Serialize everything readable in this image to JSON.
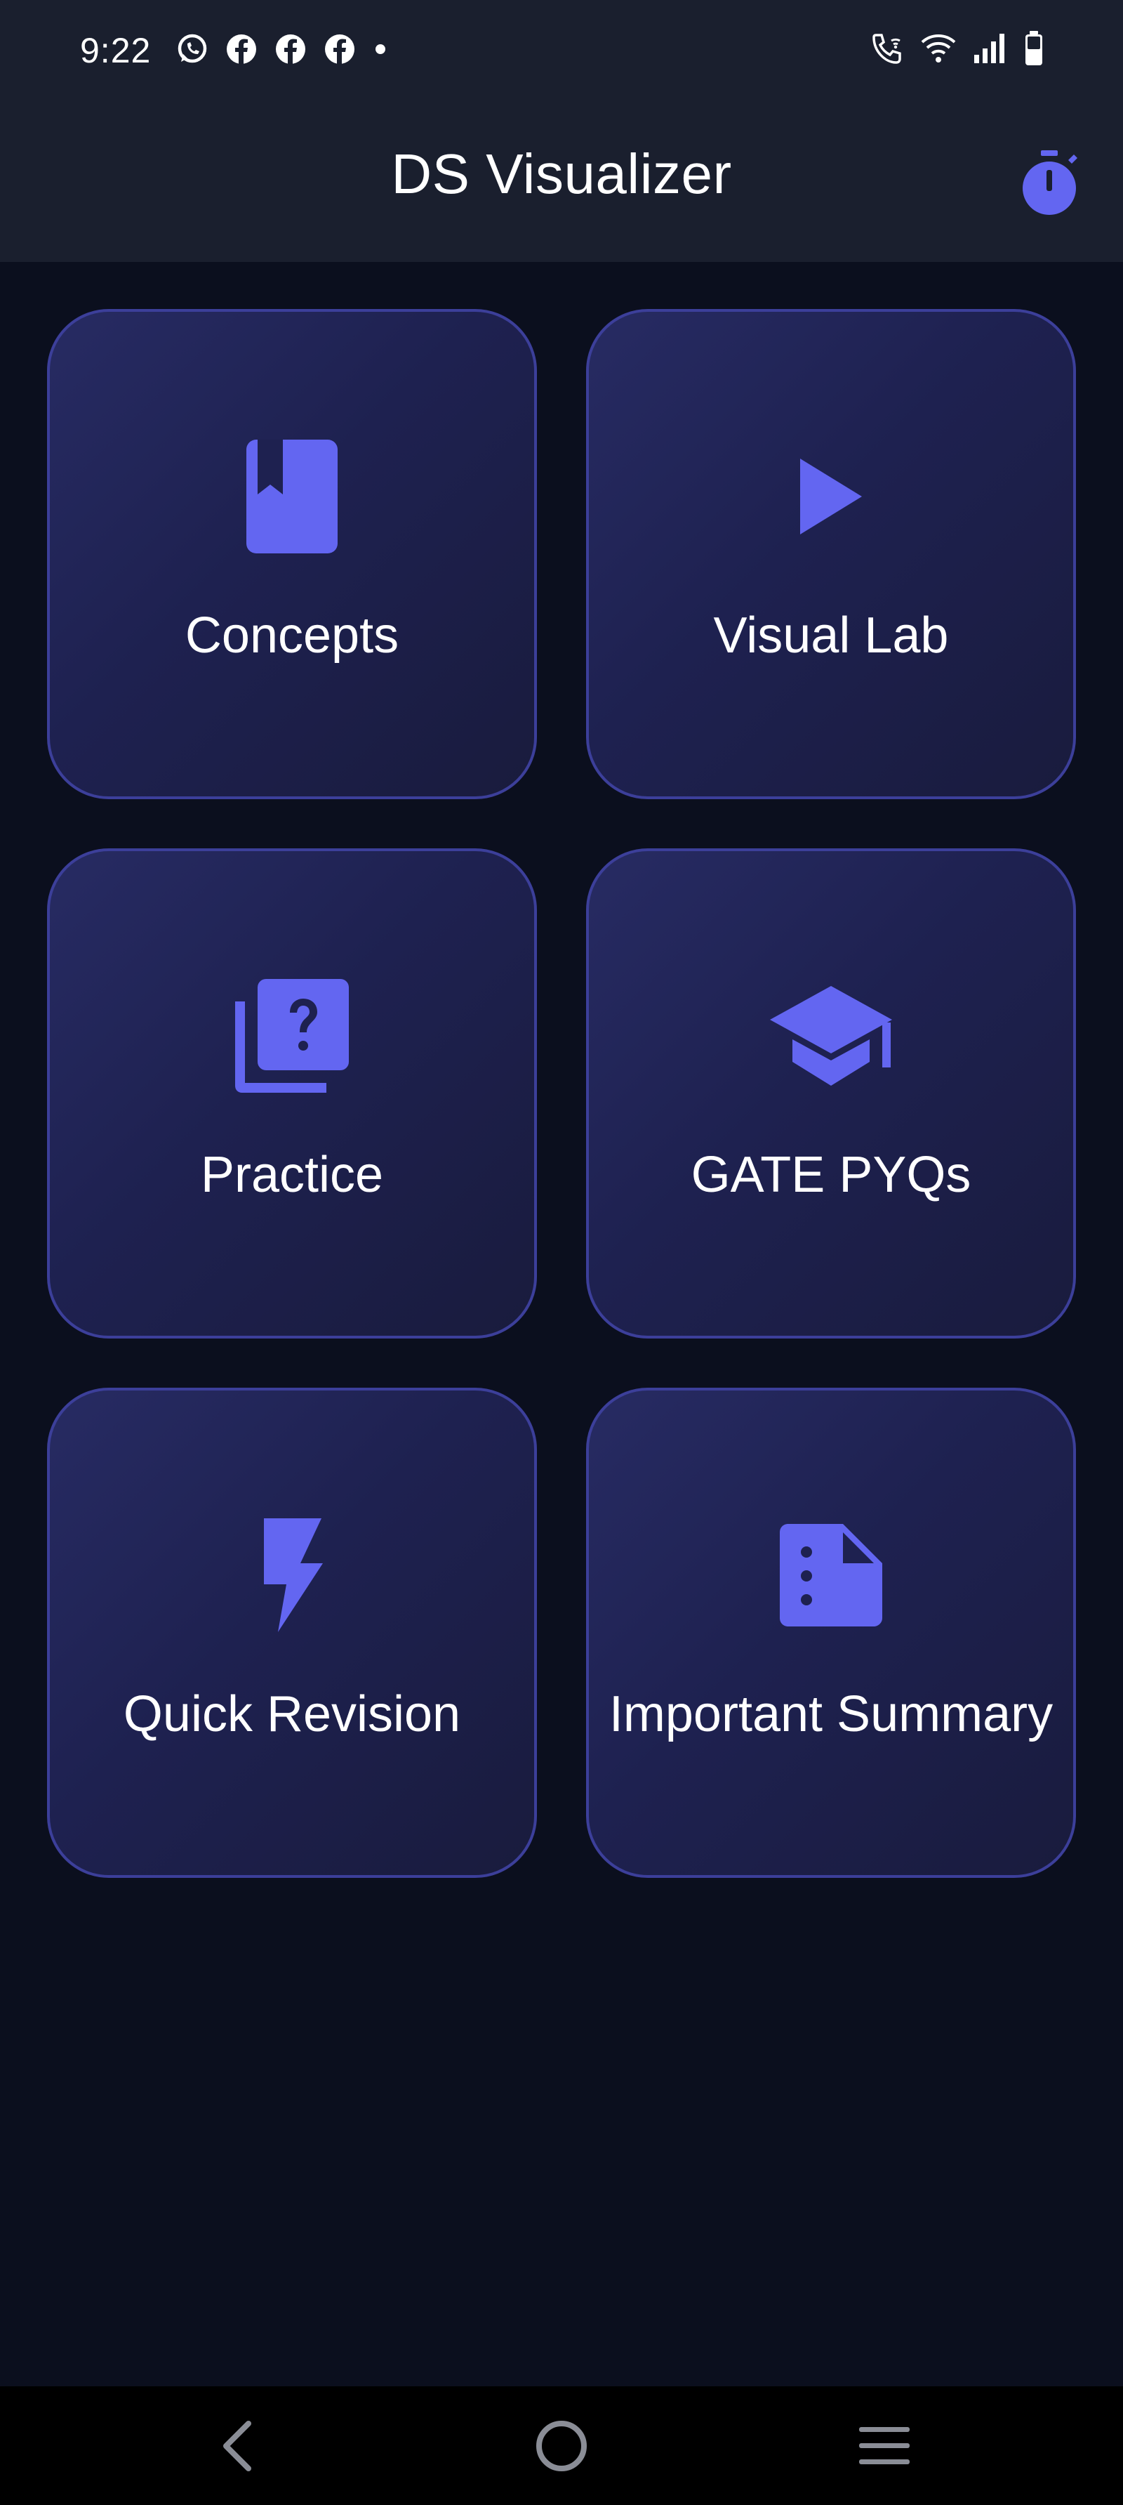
{
  "status_bar": {
    "time": "9:22",
    "left_icons": [
      "whatsapp-icon",
      "facebook-icon",
      "facebook-icon",
      "facebook-icon",
      "dot-icon"
    ],
    "right_icons": [
      "wifi-calling-icon",
      "wifi-icon",
      "signal-icon",
      "battery-icon"
    ]
  },
  "app_bar": {
    "title": "DS Visualizer",
    "action_icon": "timer-icon"
  },
  "menu": [
    {
      "label": "Concepts",
      "icon": "book-bookmark-icon"
    },
    {
      "label": "Visual Lab",
      "icon": "play-icon"
    },
    {
      "label": "Practice",
      "icon": "quiz-icon"
    },
    {
      "label": "GATE PYQs",
      "icon": "graduation-cap-icon"
    },
    {
      "label": "Quick Revision",
      "icon": "lightning-icon"
    },
    {
      "label": "Important Summary",
      "icon": "document-icon"
    }
  ],
  "nav_bar": {
    "buttons": [
      "back-icon",
      "home-icon",
      "recents-icon"
    ]
  },
  "colors": {
    "accent": "#6366f1",
    "background": "#0b0f1e",
    "bar": "#1a1f2e",
    "card_border": "#3c3f9a"
  }
}
